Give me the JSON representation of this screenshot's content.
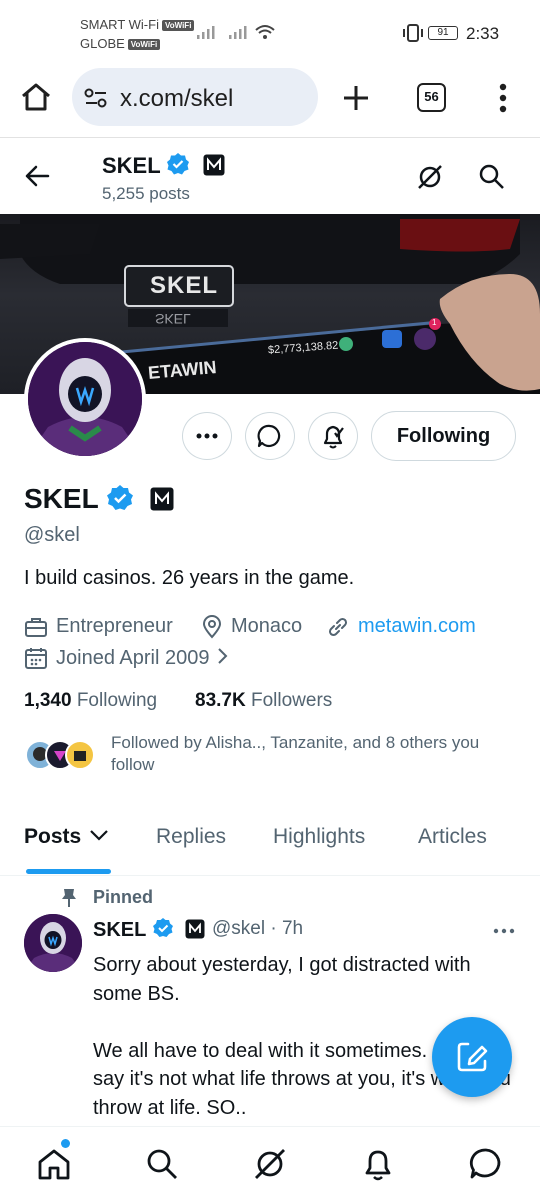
{
  "status_bar": {
    "carrier1": "SMART Wi-Fi",
    "carrier2": "GLOBE",
    "volte_tag": "VoWiFi",
    "battery": "91",
    "time": "2:33"
  },
  "browser": {
    "url": "x.com/skel",
    "tab_count": "56"
  },
  "header": {
    "title": "SKEL",
    "posts_count": "5,255 posts"
  },
  "banner": {
    "plate_text": "SKEL",
    "plate_text_lower": "SKEL",
    "brand_text": "ETAWIN",
    "balance": "$2,773,138.82",
    "notif_count": "1"
  },
  "actions": {
    "following_label": "Following"
  },
  "profile": {
    "name": "SKEL",
    "handle": "@skel",
    "bio": "I build casinos. 26 years in the game.",
    "category": "Entrepreneur",
    "location": "Monaco",
    "website": "metawin.com",
    "joined": "Joined April 2009",
    "following_count": "1,340",
    "following_label": "Following",
    "followers_count": "83.7K",
    "followers_label": "Followers",
    "followed_by": "Followed by Alisha.., Tanzanite, and 8 others you follow"
  },
  "tabs": [
    {
      "label": "Posts"
    },
    {
      "label": "Replies"
    },
    {
      "label": "Highlights"
    },
    {
      "label": "Articles"
    }
  ],
  "tweet": {
    "pinned_label": "Pinned",
    "name": "SKEL",
    "handle_time": "@skel · 7h",
    "text": "Sorry about yesterday, I got distracted with some BS.\n\nWe all have to deal with it sometimes. I always say it's not what life throws at you, it's what you throw at life. SO.."
  },
  "colors": {
    "accent": "#1d9bf0",
    "text": "#0f1419",
    "secondary": "#536471",
    "avatar_bg": "#3a1456"
  }
}
